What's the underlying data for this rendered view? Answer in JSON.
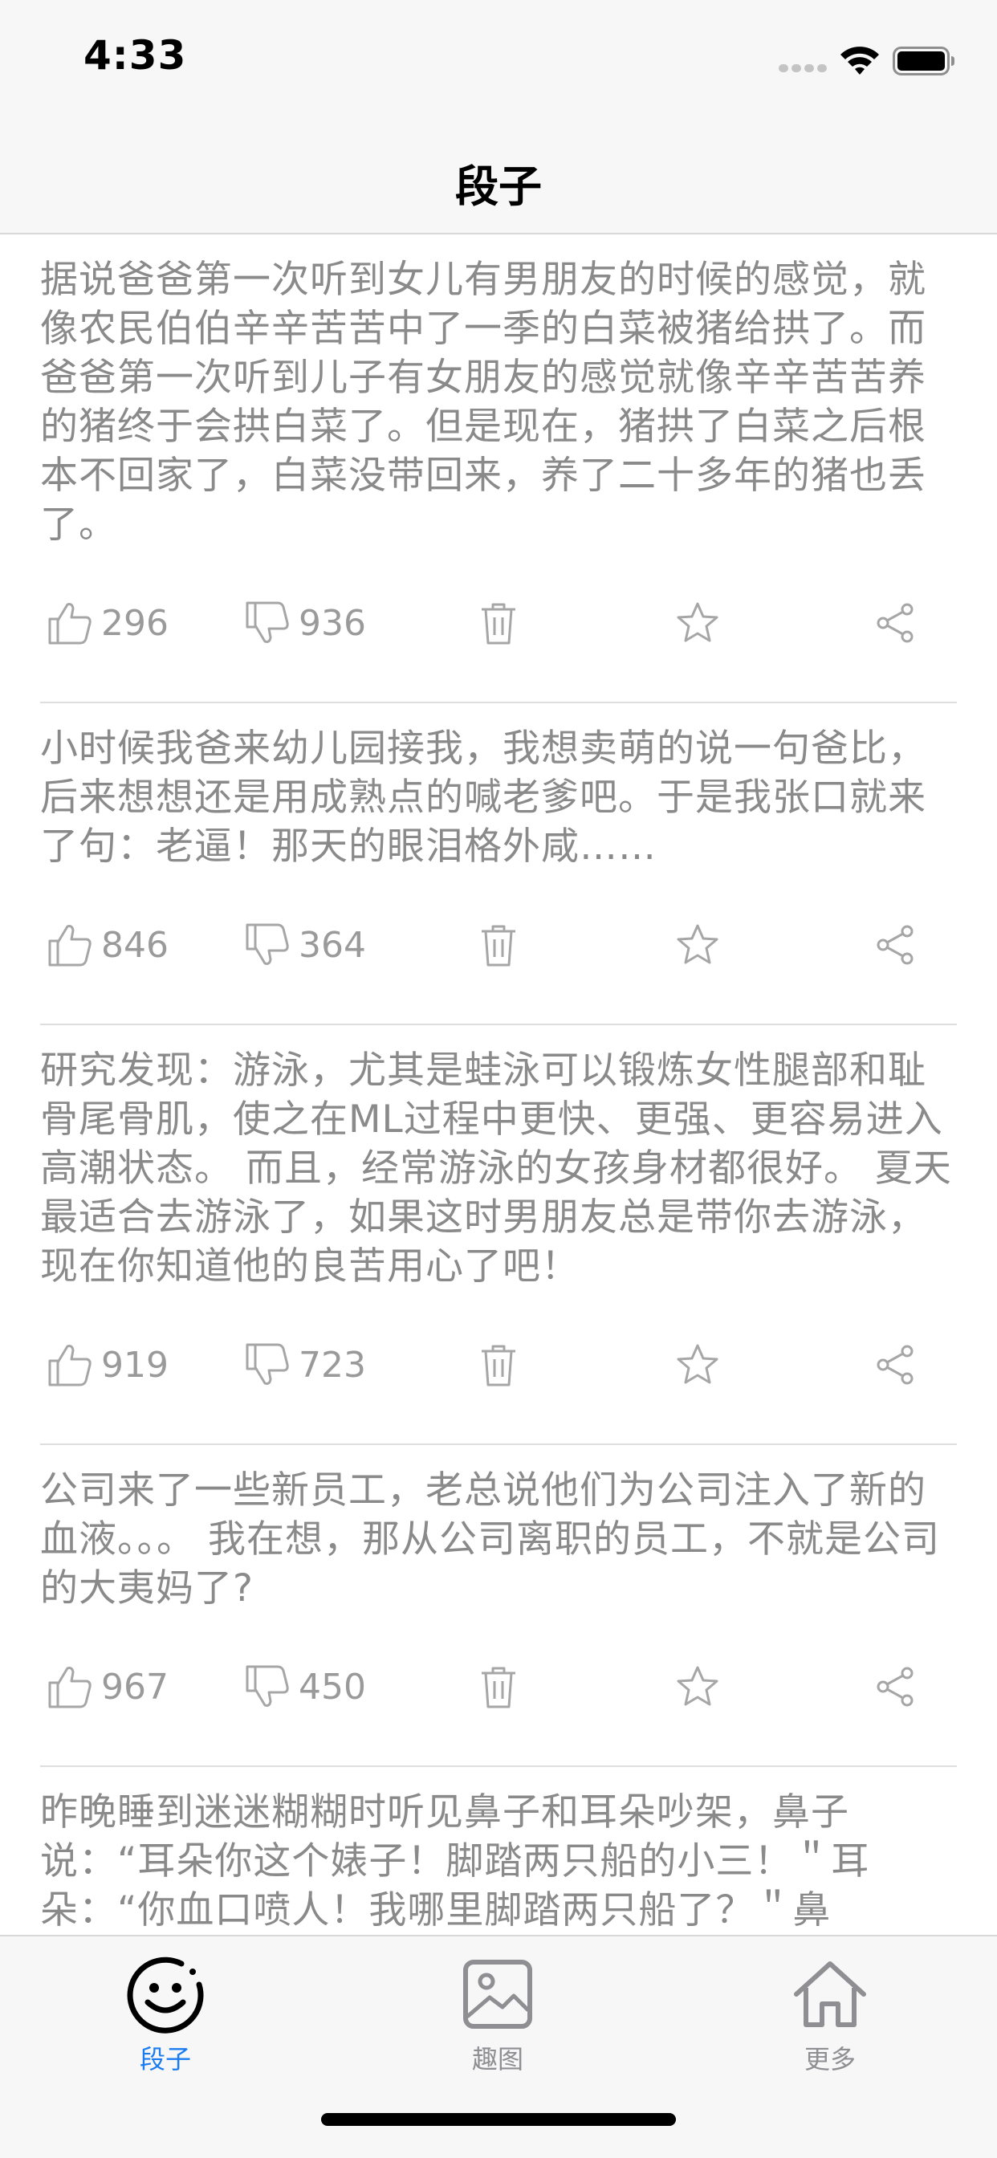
{
  "status_bar": {
    "time": "4:33"
  },
  "nav": {
    "title": "段子"
  },
  "posts": [
    {
      "text": "据说爸爸第一次听到女儿有男朋友的时候的感觉，就像农民伯伯辛辛苦苦中了一季的白菜被猪给拱了。而爸爸第一次听到儿子有女朋友的感觉就像辛辛苦苦养的猪终于会拱白菜了。但是现在，猪拱了白菜之后根本不回家了，白菜没带回来，养了二十多年的猪也丢了。",
      "likes": "296",
      "dislikes": "936"
    },
    {
      "text": "小时候我爸来幼儿园接我，我想卖萌的说一句爸比，后来想想还是用成熟点的喊老爹吧。于是我张口就来了句：老逼！那天的眼泪格外咸……",
      "likes": "846",
      "dislikes": "364"
    },
    {
      "text": "研究发现：游泳，尤其是蛙泳可以锻炼女性腿部和耻骨尾骨肌，使之在ML过程中更快、更强、更容易进入高潮状态。 而且，经常游泳的女孩身材都很好。 夏天最适合去游泳了，如果这时男朋友总是带你去游泳，现在你知道他的良苦用心了吧！",
      "likes": "919",
      "dislikes": "723"
    },
    {
      "text": "公司来了一些新员工，老总说他们为公司注入了新的血液。。。 我在想，那从公司离职的员工，不就是公司的大夷妈了?",
      "likes": "967",
      "dislikes": "450"
    },
    {
      "text": "昨晚睡到迷迷糊糊时听见鼻子和耳朵吵架，鼻子说：“耳朵你这个婊子！脚踏两只船的小三！＂耳朵：“你血口喷人！我哪里脚踏两只船了？＂鼻",
      "likes": "",
      "dislikes": ""
    }
  ],
  "tabs": [
    {
      "label": "段子",
      "icon": "smiley-face-icon",
      "active": true
    },
    {
      "label": "趣图",
      "icon": "picture-icon",
      "active": false
    },
    {
      "label": "更多",
      "icon": "home-icon",
      "active": false
    }
  ],
  "colors": {
    "active_tab": "#1a7cf0",
    "inactive_tab": "#8e8e93",
    "post_text": "#8a8a8a"
  }
}
